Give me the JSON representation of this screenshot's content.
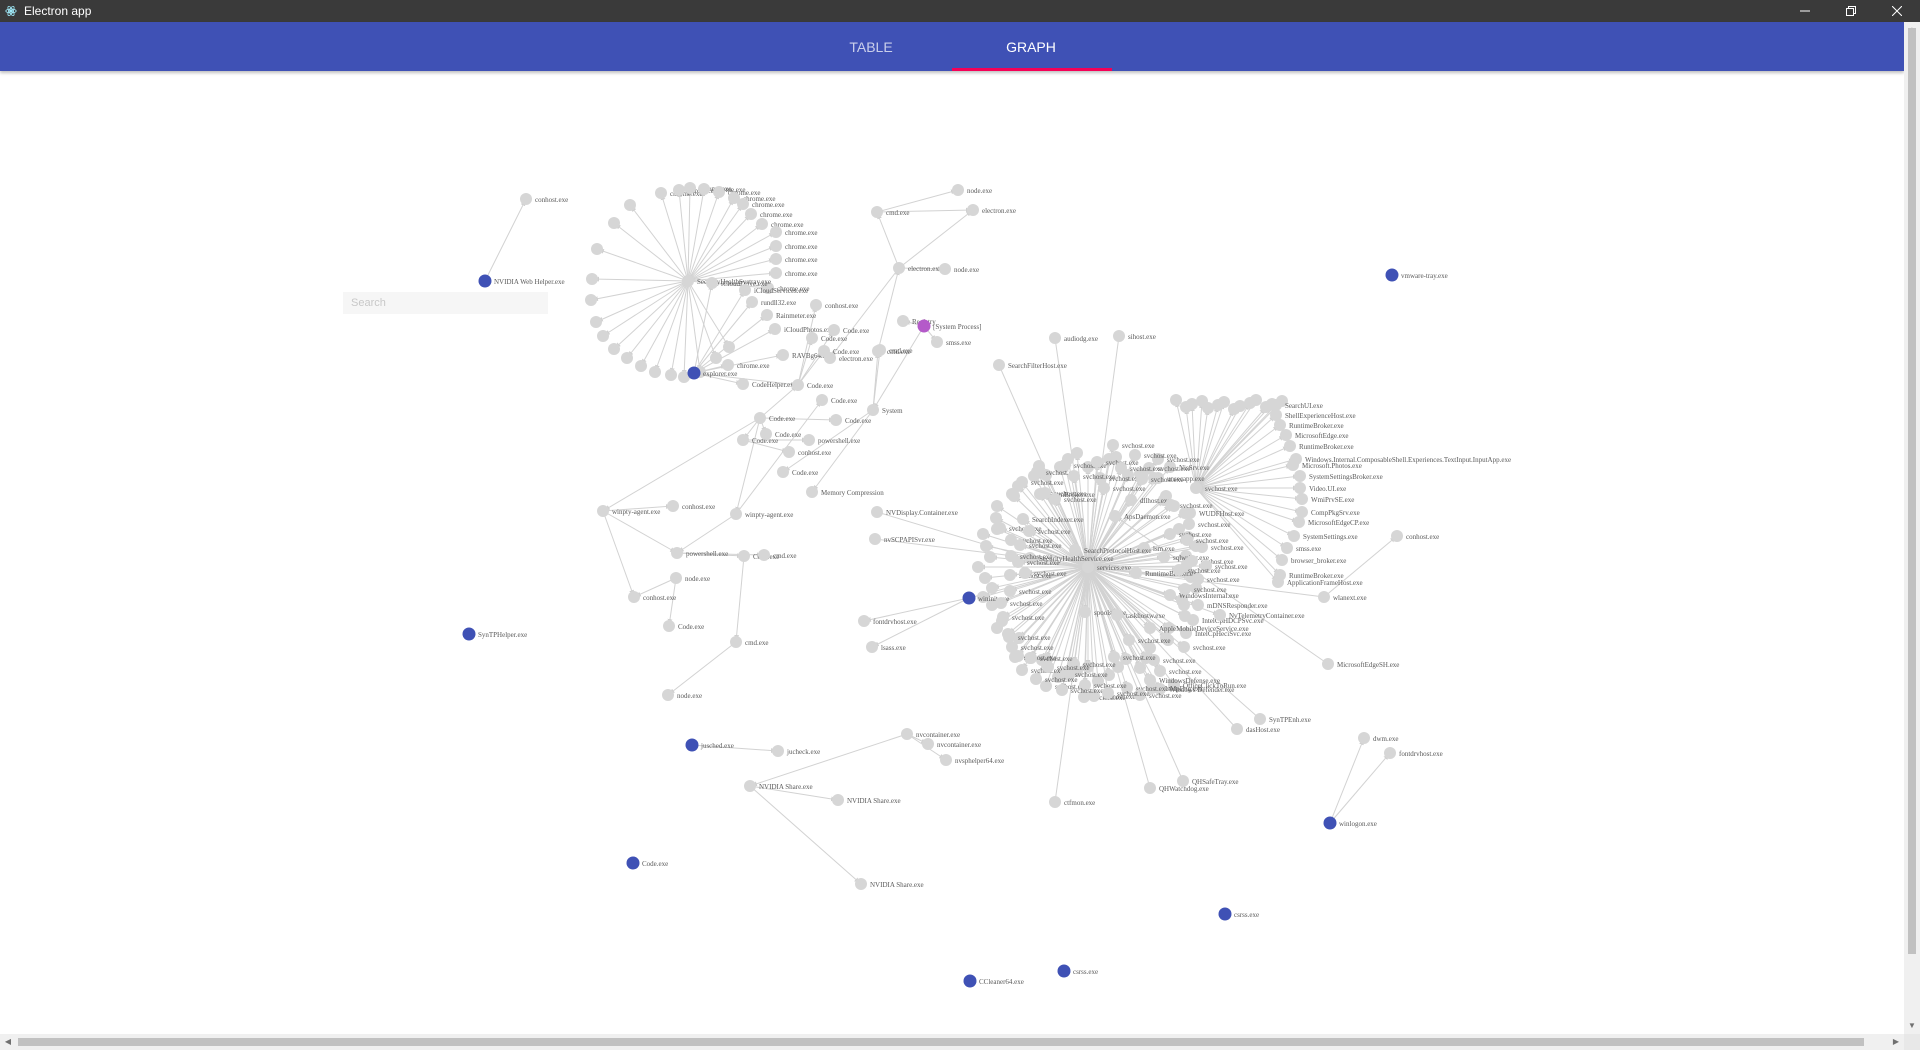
{
  "window": {
    "title": "Electron app"
  },
  "tabs": [
    {
      "label": "TABLE",
      "active": false
    },
    {
      "label": "GRAPH",
      "active": true
    }
  ],
  "search": {
    "placeholder": "Search",
    "value": ""
  },
  "colors": {
    "appbar": "#3f51b5",
    "indicator": "#f50057",
    "node": "#d6d6d6",
    "root_node": "#3f51b5",
    "system_node": "#b45ac9",
    "edge": "#d2d2d2"
  },
  "graph": {
    "center_hubs": [
      {
        "id": "h1",
        "label": "SecurityHealthSystray.exe"
      },
      {
        "id": "h2",
        "label": "services.exe"
      },
      {
        "id": "h3",
        "label": "svchost.exe"
      }
    ],
    "chrome_labels": [
      "chrome.exe",
      "chrome.exe",
      "chrome.exe",
      "chrome.exe",
      "chrome.exe",
      "chrome.exe",
      "chrome.exe",
      "chrome.exe",
      "chrome.exe",
      "chrome.exe",
      "chrome.exe",
      "chrome.exe",
      "chrome.exe",
      "chrome.exe"
    ],
    "nodes": [
      {
        "id": "n1",
        "label": "conhost.exe",
        "kind": "normal"
      },
      {
        "id": "n2",
        "label": "NVIDIA Web Helper.exe",
        "kind": "root"
      },
      {
        "id": "n3",
        "label": "node.exe",
        "kind": "normal"
      },
      {
        "id": "n4",
        "label": "cmd.exe",
        "kind": "normal"
      },
      {
        "id": "n5",
        "label": "electron.exe",
        "kind": "normal"
      },
      {
        "id": "n6",
        "label": "electron.exe",
        "kind": "normal"
      },
      {
        "id": "n7",
        "label": "node.exe",
        "kind": "normal"
      },
      {
        "id": "n8",
        "label": "vmware-tray.exe",
        "kind": "root"
      },
      {
        "id": "n9",
        "label": "Registry",
        "kind": "normal"
      },
      {
        "id": "n10",
        "label": "[System Process]",
        "kind": "system"
      },
      {
        "id": "n11",
        "label": "smss.exe",
        "kind": "normal"
      },
      {
        "id": "n12",
        "label": "cmd.exe",
        "kind": "normal"
      },
      {
        "id": "n13",
        "label": "System",
        "kind": "normal"
      },
      {
        "id": "n14",
        "label": "Memory Compression",
        "kind": "normal"
      },
      {
        "id": "n15",
        "label": "audiodg.exe",
        "kind": "normal"
      },
      {
        "id": "n16",
        "label": "sihost.exe",
        "kind": "normal"
      },
      {
        "id": "n17",
        "label": "SearchFilterHost.exe",
        "kind": "normal"
      },
      {
        "id": "n18",
        "label": "explorer.exe",
        "kind": "root"
      },
      {
        "id": "n19",
        "label": "iCloudDrive.exe",
        "kind": "normal"
      },
      {
        "id": "n20",
        "label": "iCloudServices.exe",
        "kind": "normal"
      },
      {
        "id": "n21",
        "label": "rundll32.exe",
        "kind": "normal"
      },
      {
        "id": "n22",
        "label": "Rainmeter.exe",
        "kind": "normal"
      },
      {
        "id": "n23",
        "label": "iCloudPhotos.exe",
        "kind": "normal"
      },
      {
        "id": "n24",
        "label": "RAVBg64.exe",
        "kind": "normal"
      },
      {
        "id": "n25",
        "label": "chrome.exe",
        "kind": "normal"
      },
      {
        "id": "n26",
        "label": "CodeHelper.exe",
        "kind": "normal"
      },
      {
        "id": "n27",
        "label": "Code.exe",
        "kind": "normal"
      },
      {
        "id": "n28",
        "label": "Code.exe",
        "kind": "normal"
      },
      {
        "id": "n29",
        "label": "Code.exe",
        "kind": "normal"
      },
      {
        "id": "n30",
        "label": "Code.exe",
        "kind": "normal"
      },
      {
        "id": "n31",
        "label": "Code.exe",
        "kind": "normal"
      },
      {
        "id": "n32",
        "label": "Code.exe",
        "kind": "normal"
      },
      {
        "id": "n33",
        "label": "Code.exe",
        "kind": "normal"
      },
      {
        "id": "n34",
        "label": "conhost.exe",
        "kind": "normal"
      },
      {
        "id": "n35",
        "label": "Code.exe",
        "kind": "normal"
      },
      {
        "id": "n36",
        "label": "electron.exe",
        "kind": "normal"
      },
      {
        "id": "n37",
        "label": "cmd.exe",
        "kind": "normal"
      },
      {
        "id": "n38",
        "label": "powershell.exe",
        "kind": "normal"
      },
      {
        "id": "n39",
        "label": "conhost.exe",
        "kind": "normal"
      },
      {
        "id": "n40",
        "label": "Code.exe",
        "kind": "normal"
      },
      {
        "id": "n41",
        "label": "Code.exe",
        "kind": "normal"
      },
      {
        "id": "n42",
        "label": "winpty-agent.exe",
        "kind": "normal"
      },
      {
        "id": "n43",
        "label": "conhost.exe",
        "kind": "normal"
      },
      {
        "id": "n44",
        "label": "winpty-agent.exe",
        "kind": "normal"
      },
      {
        "id": "n45",
        "label": "powershell.exe",
        "kind": "normal"
      },
      {
        "id": "n46",
        "label": "Code.exe",
        "kind": "normal"
      },
      {
        "id": "n47",
        "label": "cmd.exe",
        "kind": "normal"
      },
      {
        "id": "n48",
        "label": "node.exe",
        "kind": "normal"
      },
      {
        "id": "n49",
        "label": "conhost.exe",
        "kind": "normal"
      },
      {
        "id": "n50",
        "label": "Code.exe",
        "kind": "normal"
      },
      {
        "id": "n51",
        "label": "cmd.exe",
        "kind": "normal"
      },
      {
        "id": "n52",
        "label": "node.exe",
        "kind": "normal"
      },
      {
        "id": "n53",
        "label": "SynTPHelper.exe",
        "kind": "root"
      },
      {
        "id": "n54",
        "label": "jusched.exe",
        "kind": "root"
      },
      {
        "id": "n55",
        "label": "jucheck.exe",
        "kind": "normal"
      },
      {
        "id": "n56",
        "label": "Code.exe",
        "kind": "root"
      },
      {
        "id": "n57",
        "label": "NVDisplay.Container.exe",
        "kind": "normal"
      },
      {
        "id": "n58",
        "label": "nvSCPAPISvr.exe",
        "kind": "normal"
      },
      {
        "id": "n59",
        "label": "fontdrvhost.exe",
        "kind": "normal"
      },
      {
        "id": "n60",
        "label": "lsass.exe",
        "kind": "normal"
      },
      {
        "id": "n61",
        "label": "wininit.exe",
        "kind": "root"
      },
      {
        "id": "n62",
        "label": "nvcontainer.exe",
        "kind": "normal"
      },
      {
        "id": "n63",
        "label": "nvcontainer.exe",
        "kind": "normal"
      },
      {
        "id": "n64",
        "label": "nvsphelper64.exe",
        "kind": "normal"
      },
      {
        "id": "n65",
        "label": "NVIDIA Share.exe",
        "kind": "normal"
      },
      {
        "id": "n66",
        "label": "NVIDIA Share.exe",
        "kind": "normal"
      },
      {
        "id": "n67",
        "label": "NVIDIA Share.exe",
        "kind": "normal"
      },
      {
        "id": "n68",
        "label": "ctfmon.exe",
        "kind": "normal"
      },
      {
        "id": "n69",
        "label": "QHWatchdog.exe",
        "kind": "normal"
      },
      {
        "id": "n70",
        "label": "QHSafeTray.exe",
        "kind": "normal"
      },
      {
        "id": "n71",
        "label": "SynTPEnh.exe",
        "kind": "normal"
      },
      {
        "id": "n72",
        "label": "dasHost.exe",
        "kind": "normal"
      },
      {
        "id": "n73",
        "label": "dwm.exe",
        "kind": "normal"
      },
      {
        "id": "n74",
        "label": "fontdrvhost.exe",
        "kind": "normal"
      },
      {
        "id": "n75",
        "label": "winlogon.exe",
        "kind": "root"
      },
      {
        "id": "n76",
        "label": "csrss.exe",
        "kind": "root"
      },
      {
        "id": "n77",
        "label": "csrss.exe",
        "kind": "root"
      },
      {
        "id": "n78",
        "label": "CCleaner64.exe",
        "kind": "root"
      },
      {
        "id": "n79",
        "label": "conhost.exe",
        "kind": "normal"
      },
      {
        "id": "n80",
        "label": "wlanext.exe",
        "kind": "normal"
      },
      {
        "id": "n81",
        "label": "MicrosoftEdgeSH.exe",
        "kind": "normal"
      },
      {
        "id": "n82",
        "label": "RuntimeBroker.exe",
        "kind": "normal"
      },
      {
        "id": "n83",
        "label": "ApplicationFrameHost.exe",
        "kind": "normal"
      },
      {
        "id": "n84",
        "label": "browser_broker.exe",
        "kind": "normal"
      },
      {
        "id": "n85",
        "label": "smss.exe",
        "kind": "normal"
      },
      {
        "id": "n86",
        "label": "SystemSettings.exe",
        "kind": "normal"
      },
      {
        "id": "n87",
        "label": "MicrosoftEdgeCP.exe",
        "kind": "normal"
      },
      {
        "id": "n88",
        "label": "CompPkgSrv.exe",
        "kind": "normal"
      },
      {
        "id": "n89",
        "label": "WmiPrvSE.exe",
        "kind": "normal"
      },
      {
        "id": "n90",
        "label": "Video.UI.exe",
        "kind": "normal"
      },
      {
        "id": "n91",
        "label": "SystemSettingsBroker.exe",
        "kind": "normal"
      },
      {
        "id": "n92",
        "label": "Windows.Internal.ComposableShell.Experiences.TextInput.InputApp.exe",
        "kind": "normal"
      },
      {
        "id": "n93",
        "label": "Microsoft.Photos.exe",
        "kind": "normal"
      },
      {
        "id": "n94",
        "label": "RuntimeBroker.exe",
        "kind": "normal"
      },
      {
        "id": "n95",
        "label": "MicrosoftEdge.exe",
        "kind": "normal"
      },
      {
        "id": "n96",
        "label": "ShellExperienceHost.exe",
        "kind": "normal"
      },
      {
        "id": "n97",
        "label": "RuntimeBroker.exe",
        "kind": "normal"
      },
      {
        "id": "n98",
        "label": "SearchUI.exe",
        "kind": "normal"
      },
      {
        "id": "n99",
        "label": "ApsDaemon.exe",
        "kind": "normal"
      },
      {
        "id": "n100",
        "label": "WUDFHost.exe",
        "kind": "normal"
      },
      {
        "id": "n101",
        "label": "svchost.exe",
        "kind": "normal"
      },
      {
        "id": "n102",
        "label": "RuntimeBroker.exe",
        "kind": "normal"
      },
      {
        "id": "n103",
        "label": "WindowsInternal.exe",
        "kind": "normal"
      },
      {
        "id": "n104",
        "label": "mDNSResponder.exe",
        "kind": "normal"
      },
      {
        "id": "n105",
        "label": "IntelCpHDCPSvc.exe",
        "kind": "normal"
      },
      {
        "id": "n106",
        "label": "NvTelemetryContainer.exe",
        "kind": "normal"
      },
      {
        "id": "n107",
        "label": "IntelCpHeciSvc.exe",
        "kind": "normal"
      },
      {
        "id": "n108",
        "label": "AppleMobileDeviceService.exe",
        "kind": "normal"
      },
      {
        "id": "n109",
        "label": "OfficeClickToRun.exe",
        "kind": "normal"
      },
      {
        "id": "n110",
        "label": "MsMpEng.exe",
        "kind": "normal"
      },
      {
        "id": "n111",
        "label": "SecurityHealthService.exe",
        "kind": "normal"
      },
      {
        "id": "n112",
        "label": "SearchIndexer.exe",
        "kind": "normal"
      },
      {
        "id": "n113",
        "label": "spoolsv.exe",
        "kind": "normal"
      },
      {
        "id": "n114",
        "label": "lsm.exe",
        "kind": "normal"
      },
      {
        "id": "n115",
        "label": "SgrmBroker.exe",
        "kind": "normal"
      },
      {
        "id": "n116",
        "label": "WindowsDefense.exe",
        "kind": "normal"
      },
      {
        "id": "n117",
        "label": "dllhost.exe",
        "kind": "normal"
      },
      {
        "id": "n118",
        "label": "svchost.exe",
        "kind": "normal"
      },
      {
        "id": "n119",
        "label": "sqlwriter.exe",
        "kind": "normal"
      },
      {
        "id": "n120",
        "label": "NisSrv.exe",
        "kind": "normal"
      },
      {
        "id": "n121",
        "label": "unsecapp.exe",
        "kind": "normal"
      },
      {
        "id": "n122",
        "label": "SearchProtocolHost.exe",
        "kind": "normal"
      },
      {
        "id": "n123",
        "label": "Windows Defender.exe",
        "kind": "normal"
      },
      {
        "id": "n124",
        "label": "svchost.exe",
        "kind": "normal"
      },
      {
        "id": "n125",
        "label": "svchost.exe",
        "kind": "normal"
      },
      {
        "id": "n126",
        "label": "svchost.exe",
        "kind": "normal"
      },
      {
        "id": "n127",
        "label": "svchost.exe",
        "kind": "normal"
      },
      {
        "id": "n128",
        "label": "taskhostw.exe",
        "kind": "normal"
      },
      {
        "id": "n129",
        "label": "svchost.exe",
        "kind": "normal"
      },
      {
        "id": "n130",
        "label": "svchost.exe",
        "kind": "normal"
      },
      {
        "id": "n131",
        "label": "svchost.exe",
        "kind": "normal"
      },
      {
        "id": "n132",
        "label": "svchost.exe",
        "kind": "normal"
      },
      {
        "id": "n133",
        "label": "svchost.exe",
        "kind": "normal"
      },
      {
        "id": "n134",
        "label": "svchost.exe",
        "kind": "normal"
      },
      {
        "id": "n135",
        "label": "svchost.exe",
        "kind": "normal"
      },
      {
        "id": "n136",
        "label": "svchost.exe",
        "kind": "normal"
      },
      {
        "id": "n137",
        "label": "svchost.exe",
        "kind": "normal"
      },
      {
        "id": "n138",
        "label": "svchost.exe",
        "kind": "normal"
      },
      {
        "id": "n139",
        "label": "svchost.exe",
        "kind": "normal"
      },
      {
        "id": "n140",
        "label": "svchost.exe",
        "kind": "normal"
      },
      {
        "id": "n141",
        "label": "svchost.exe",
        "kind": "normal"
      },
      {
        "id": "n142",
        "label": "svchost.exe",
        "kind": "normal"
      },
      {
        "id": "n143",
        "label": "svchost.exe",
        "kind": "normal"
      },
      {
        "id": "n144",
        "label": "svchost.exe",
        "kind": "normal"
      },
      {
        "id": "n145",
        "label": "svchost.exe",
        "kind": "normal"
      },
      {
        "id": "n146",
        "label": "svchost.exe",
        "kind": "normal"
      },
      {
        "id": "n147",
        "label": "svchost.exe",
        "kind": "normal"
      },
      {
        "id": "n148",
        "label": "svchost.exe",
        "kind": "normal"
      },
      {
        "id": "n149",
        "label": "svchost.exe",
        "kind": "normal"
      },
      {
        "id": "n150",
        "label": "svchost.exe",
        "kind": "normal"
      },
      {
        "id": "n151",
        "label": "svchost.exe",
        "kind": "normal"
      },
      {
        "id": "n152",
        "label": "svchost.exe",
        "kind": "normal"
      },
      {
        "id": "n153",
        "label": "svchost.exe",
        "kind": "normal"
      },
      {
        "id": "n154",
        "label": "svchost.exe",
        "kind": "normal"
      },
      {
        "id": "n155",
        "label": "svchost.exe",
        "kind": "normal"
      },
      {
        "id": "n156",
        "label": "svchost.exe",
        "kind": "normal"
      },
      {
        "id": "n157",
        "label": "svchost.exe",
        "kind": "normal"
      },
      {
        "id": "n158",
        "label": "svchost.exe",
        "kind": "normal"
      },
      {
        "id": "n159",
        "label": "svchost.exe",
        "kind": "normal"
      },
      {
        "id": "n160",
        "label": "svchost.exe",
        "kind": "normal"
      },
      {
        "id": "n161",
        "label": "svchost.exe",
        "kind": "normal"
      },
      {
        "id": "n162",
        "label": "svchost.exe",
        "kind": "normal"
      },
      {
        "id": "n163",
        "label": "svchost.exe",
        "kind": "normal"
      },
      {
        "id": "n164",
        "label": "svchost.exe",
        "kind": "normal"
      },
      {
        "id": "n165",
        "label": "svchost.exe",
        "kind": "normal"
      },
      {
        "id": "n166",
        "label": "svchost.exe",
        "kind": "normal"
      },
      {
        "id": "n167",
        "label": "svchost.exe",
        "kind": "normal"
      },
      {
        "id": "n168",
        "label": "svchost.exe",
        "kind": "normal"
      },
      {
        "id": "n169",
        "label": "svchost.exe",
        "kind": "normal"
      },
      {
        "id": "n170",
        "label": "svchost.exe",
        "kind": "normal"
      },
      {
        "id": "n171",
        "label": "svchost.exe",
        "kind": "normal"
      },
      {
        "id": "n172",
        "label": "svchost.exe",
        "kind": "normal"
      },
      {
        "id": "n173",
        "label": "svchost.exe",
        "kind": "normal"
      },
      {
        "id": "n174",
        "label": "svchost.exe",
        "kind": "normal"
      },
      {
        "id": "n175",
        "label": "svchost.exe",
        "kind": "normal"
      },
      {
        "id": "n176",
        "label": "svchost.exe",
        "kind": "normal"
      },
      {
        "id": "n177",
        "label": "svchost.exe",
        "kind": "normal"
      },
      {
        "id": "n178",
        "label": "svchost.exe",
        "kind": "normal"
      },
      {
        "id": "n179",
        "label": "svchost.exe",
        "kind": "normal"
      },
      {
        "id": "n180",
        "label": "svchost.exe",
        "kind": "normal"
      }
    ]
  }
}
